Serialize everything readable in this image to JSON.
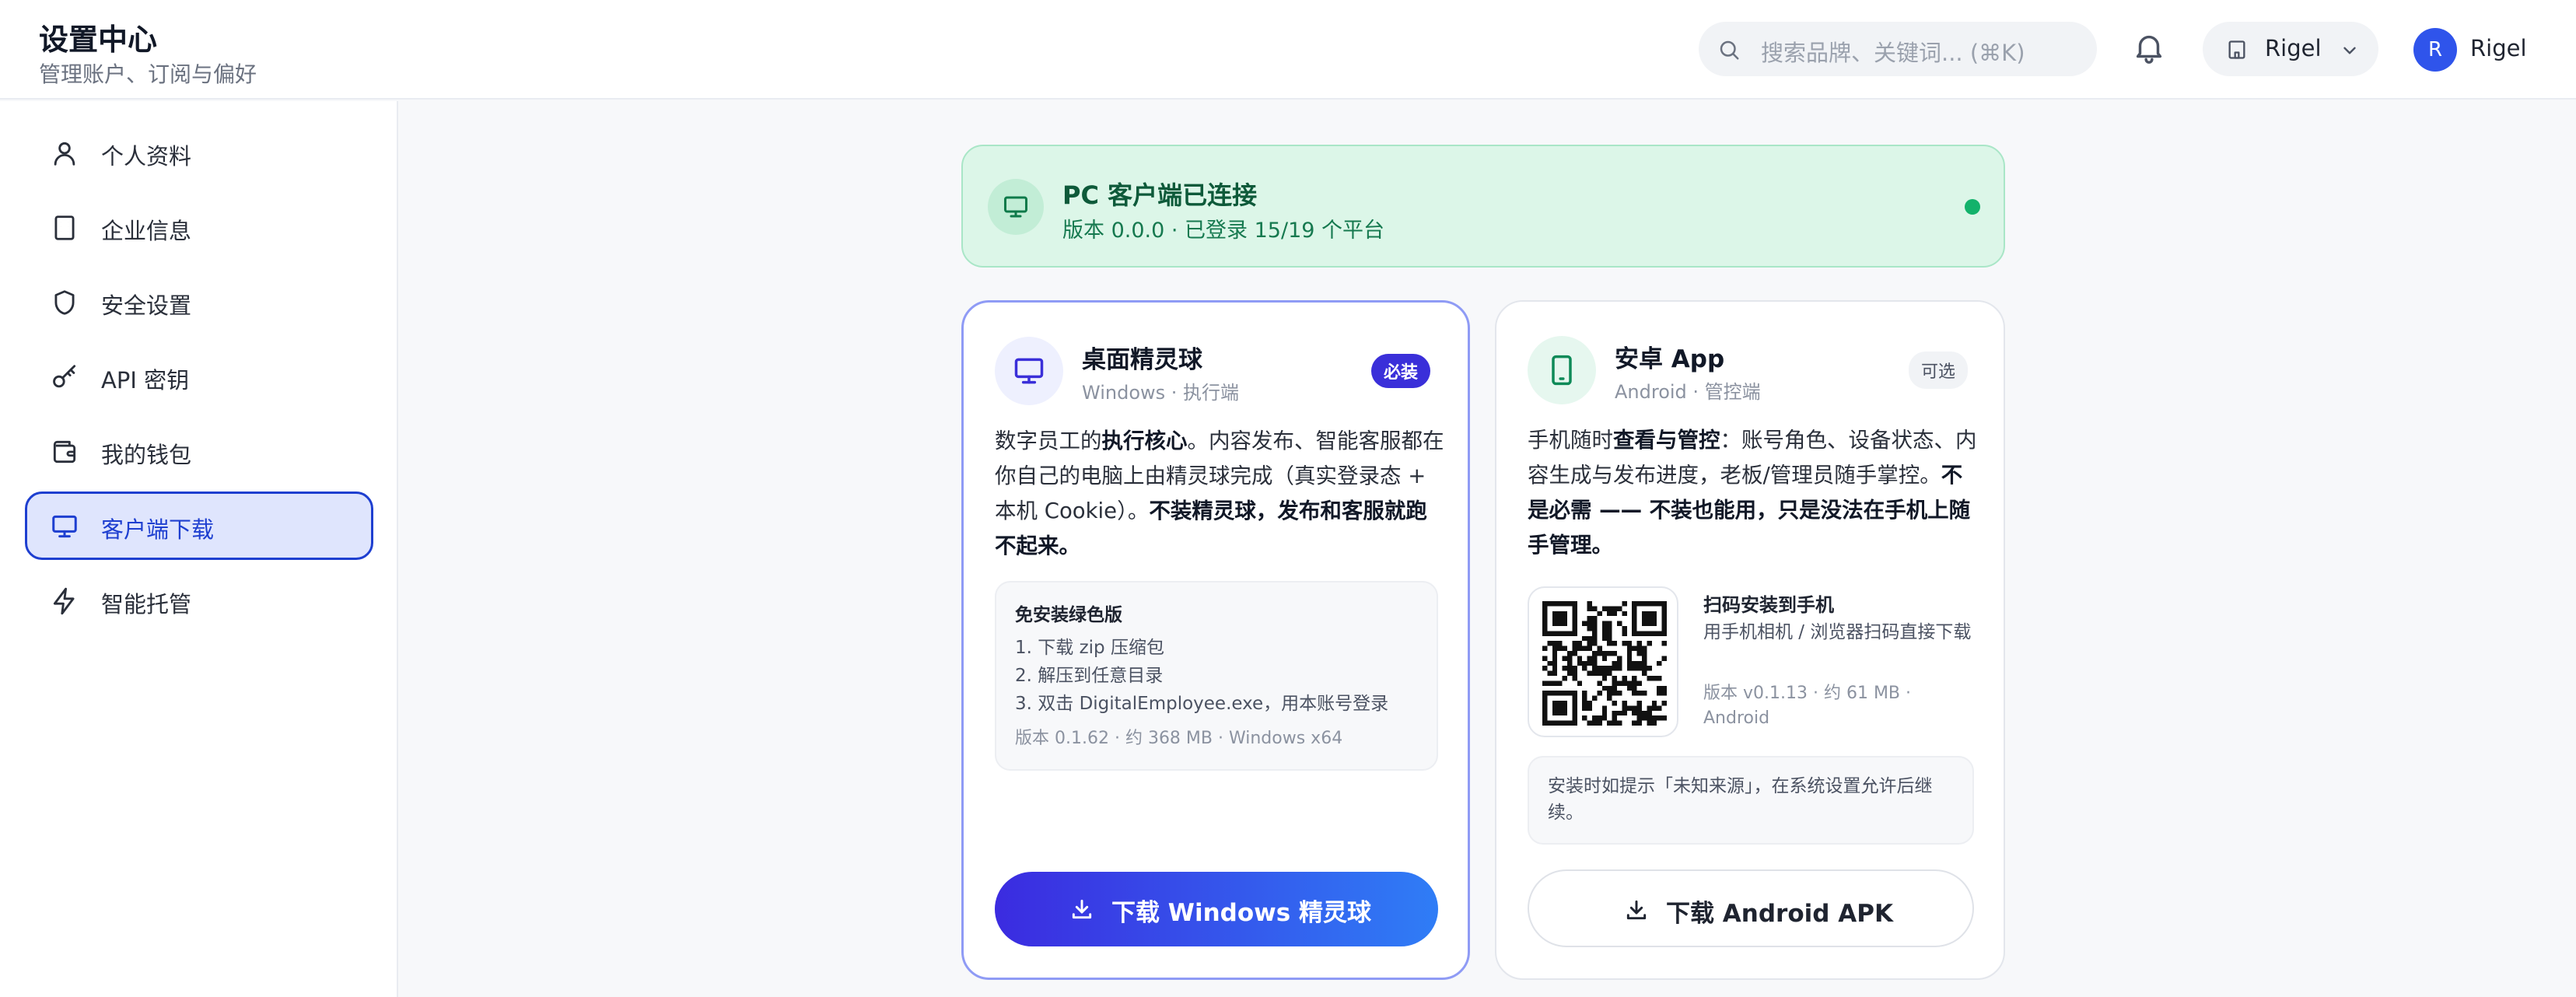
{
  "header": {
    "title": "设置中心",
    "subtitle": "管理账户、订阅与偏好",
    "search_placeholder": "搜索品牌、关键词... (⌘K)",
    "org_name": "Rigel",
    "avatar_letter": "R",
    "user_name": "Rigel"
  },
  "sidebar": {
    "items": [
      {
        "label": "个人资料",
        "icon": "user-icon"
      },
      {
        "label": "企业信息",
        "icon": "building-icon"
      },
      {
        "label": "安全设置",
        "icon": "shield-icon"
      },
      {
        "label": "API 密钥",
        "icon": "key-icon"
      },
      {
        "label": "我的钱包",
        "icon": "wallet-icon"
      },
      {
        "label": "客户端下载",
        "icon": "monitor-icon",
        "active": true
      },
      {
        "label": "智能托管",
        "icon": "lightning-icon"
      }
    ]
  },
  "banner": {
    "title": "PC 客户端已连接",
    "subtitle": "版本 0.0.0 · 已登录 15/19 个平台",
    "status_color": "#13b26b"
  },
  "windows_card": {
    "title": "桌面精灵球",
    "subtitle": "Windows · 执行端",
    "badge": "必装",
    "desc_1": "数字员工的",
    "desc_bold_1": "执行核心",
    "desc_2": "。内容发布、智能客服都在你自己的电脑上由精灵球完成（真实登录态 + 本机 Cookie）。",
    "desc_bold_2": "不装精灵球，发布和客服就跑不起来。",
    "steps_title": "免安装绿色版",
    "steps": [
      "1. 下载 zip 压缩包",
      "2. 解压到任意目录",
      "3. 双击 DigitalEmployee.exe，用本账号登录"
    ],
    "meta": "版本 0.1.62 · 约 368 MB · Windows x64",
    "download_label": "下载 Windows 精灵球"
  },
  "android_card": {
    "title": "安卓 App",
    "subtitle": "Android · 管控端",
    "badge": "可选",
    "desc_1": "手机随时",
    "desc_bold_1": "查看与管控",
    "desc_2": "：账号角色、设备状态、内容生成与发布进度，老板/管理员随手掌控。",
    "desc_bold_2": "不是必需 —— 不装也能用，只是没法在手机上随手管理。",
    "qr_title": "扫码安装到手机",
    "qr_desc": "用手机相机 / 浏览器扫码直接下载",
    "qr_meta": "版本 v0.1.13 · 约 61 MB · Android",
    "notice": "安装时如提示「未知来源」，在系统设置允许后继续。",
    "download_label": "下载 Android APK"
  }
}
